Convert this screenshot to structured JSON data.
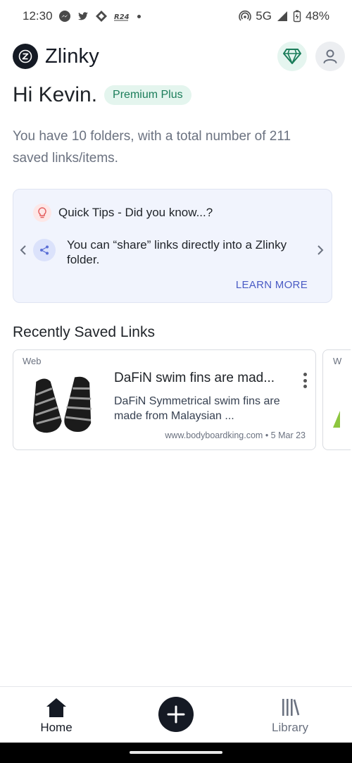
{
  "status_bar": {
    "time": "12:30",
    "network": "5G",
    "battery": "48%",
    "notification_icons": [
      "messenger-icon",
      "twitter-icon",
      "tidal-icon",
      "app-icon"
    ]
  },
  "header": {
    "app_name": "Zlinky",
    "logo_letter": "Z",
    "premium_icon": "diamond-icon",
    "profile_icon": "person-icon"
  },
  "greeting": {
    "text": "Hi Kevin.",
    "badge": "Premium Plus"
  },
  "summary": "You have 10 folders, with a total number of 211 saved links/items.",
  "tips": {
    "title": "Quick Tips - Did you know...?",
    "body": "You can “share” links directly into a Zlinky folder.",
    "action": "LEARN MORE",
    "tip_icon": "share-icon"
  },
  "recent": {
    "title": "Recently Saved Links",
    "items": [
      {
        "type": "Web",
        "title": "DaFiN swim fins are mad...",
        "description": "DaFiN Symmetrical swim fins are made from Malaysian ...",
        "meta": "www.bodyboardking.com • 5 Mar 23"
      },
      {
        "type": "W"
      }
    ]
  },
  "nav": {
    "home": "Home",
    "library": "Library",
    "add_icon": "plus-icon"
  },
  "colors": {
    "brand_dark": "#151a24",
    "premium_green": "#1b7d5a",
    "tips_bg": "#f1f4fd",
    "link_blue": "#4a5bc4"
  }
}
